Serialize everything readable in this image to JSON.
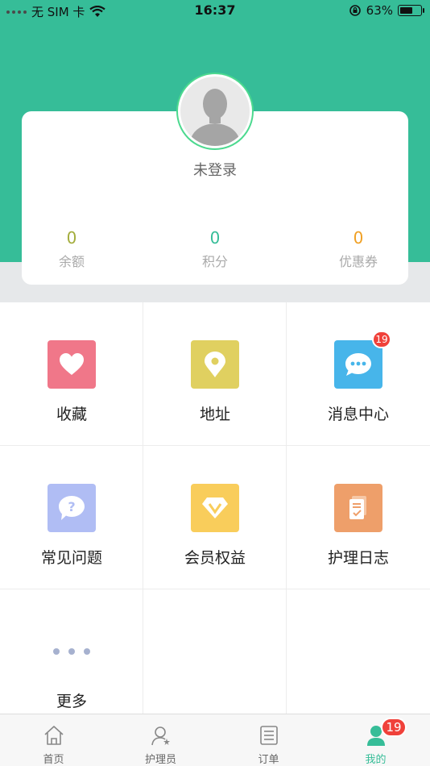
{
  "status_bar": {
    "carrier": "无 SIM 卡",
    "time": "16:37",
    "battery": "63%",
    "battery_level": 0.63
  },
  "profile": {
    "login_status": "未登录",
    "stats": [
      {
        "value": "0",
        "label": "余额",
        "color": "#a3ad3c"
      },
      {
        "value": "0",
        "label": "积分",
        "color": "#36bd98"
      },
      {
        "value": "0",
        "label": "优惠券",
        "color": "#f0a024"
      }
    ]
  },
  "menu": {
    "items": [
      {
        "label": "收藏",
        "icon": "heart-icon",
        "color": "#f07789"
      },
      {
        "label": "地址",
        "icon": "location-pin-icon",
        "color": "#e0d060"
      },
      {
        "label": "消息中心",
        "icon": "chat-bubble-icon",
        "color": "#47b5ea",
        "badge": "19"
      },
      {
        "label": "常见问题",
        "icon": "question-bubble-icon",
        "color": "#b0bdf4"
      },
      {
        "label": "会员权益",
        "icon": "vip-diamond-icon",
        "color": "#f9cd5b"
      },
      {
        "label": "护理日志",
        "icon": "log-document-icon",
        "color": "#ee9f6a"
      },
      {
        "label": "更多",
        "icon": "more-dots-icon",
        "color": "#a6b1cf"
      }
    ]
  },
  "tabbar": {
    "tabs": [
      {
        "label": "首页",
        "icon": "home-icon"
      },
      {
        "label": "护理员",
        "icon": "caregiver-icon"
      },
      {
        "label": "订单",
        "icon": "order-list-icon"
      },
      {
        "label": "我的",
        "icon": "profile-icon",
        "badge": "19",
        "active": true
      }
    ],
    "active_color": "#36bd98",
    "inactive_color": "#666666"
  }
}
